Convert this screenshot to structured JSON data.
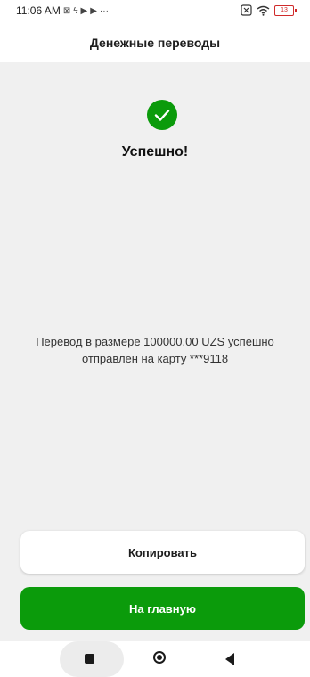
{
  "status_bar": {
    "time": "11:06 AM",
    "battery_level": "13"
  },
  "header": {
    "title": "Денежные переводы"
  },
  "result": {
    "title": "Успешно!",
    "message": "Перевод в размере 100000.00 UZS успешно отправлен на карту ***9118"
  },
  "actions": {
    "copy_label": "Копировать",
    "home_label": "На главную"
  },
  "colors": {
    "accent": "#0b9b0b",
    "background": "#f0f0f0"
  },
  "icons": {
    "success": "check-circle-icon",
    "nav_recents": "square-icon",
    "nav_home": "circle-icon",
    "nav_back": "triangle-left-icon"
  }
}
